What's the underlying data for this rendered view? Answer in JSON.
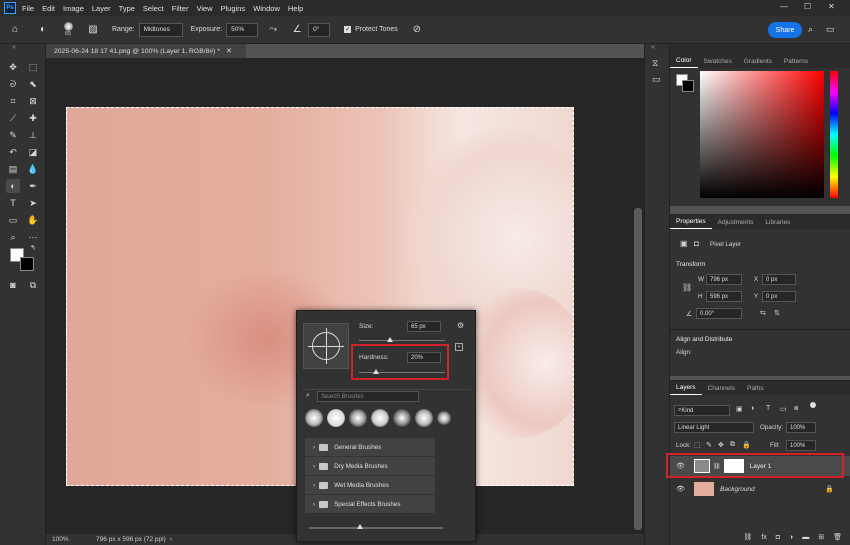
{
  "menu": {
    "app_icon": "Ps",
    "items": [
      "File",
      "Edit",
      "Image",
      "Layer",
      "Type",
      "Select",
      "Filter",
      "View",
      "Plugins",
      "Window",
      "Help"
    ]
  },
  "options": {
    "brush_size": "65",
    "range_label": "Range:",
    "range_value": "Midtones",
    "exposure_label": "Exposure:",
    "exposure_value": "50%",
    "angle_value": "0°",
    "protect_tones": "Protect Tones",
    "share": "Share"
  },
  "document": {
    "tab_title": "2025-06-24 18 17 41.png @ 100% (Layer 1, RGB/8#) *",
    "zoom": "100%",
    "info": "796 px x 596 px (72 ppi)"
  },
  "brush_popup": {
    "size_label": "Size:",
    "size_value": "65 px",
    "hardness_label": "Hardness:",
    "hardness_value": "20%",
    "hardness_fraction": 0.2,
    "size_fraction": 0.36,
    "search_placeholder": "Search Brushes",
    "folders": [
      "General Brushes",
      "Dry Media Brushes",
      "Wet Media Brushes",
      "Special Effects Brushes"
    ]
  },
  "color_panel": {
    "tabs": [
      "Color",
      "Swatches",
      "Gradients",
      "Patterns"
    ],
    "active": "Color"
  },
  "properties": {
    "tabs": [
      "Properties",
      "Adjustments",
      "Libraries"
    ],
    "active": "Properties",
    "kind": "Pixel Layer",
    "transform_heading": "Transform",
    "w": "796 px",
    "h": "596 px",
    "x": "0 px",
    "y": "0 px",
    "angle": "0.00°",
    "align_heading": "Align and Distribute",
    "align_label": "Align:"
  },
  "layers_panel": {
    "tabs": [
      "Layers",
      "Channels",
      "Paths"
    ],
    "active": "Layers",
    "filter": "Kind",
    "blend_mode": "Linear Light",
    "opacity_label": "Opacity:",
    "opacity": "100%",
    "lock_label": "Lock:",
    "fill_label": "Fill:",
    "fill": "100%",
    "layers": [
      {
        "name": "Layer 1"
      },
      {
        "name": "Background"
      }
    ]
  },
  "colors": {
    "highlight": "#d2232a",
    "accent": "#1473e6"
  }
}
